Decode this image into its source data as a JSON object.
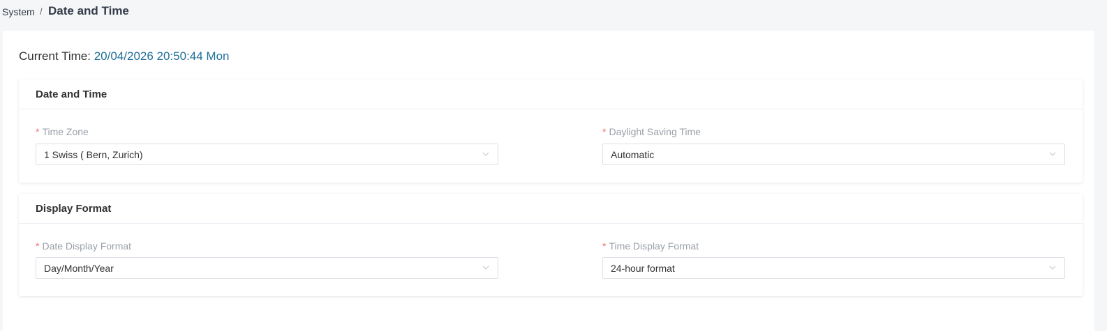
{
  "breadcrumb": {
    "parent": "System",
    "separator": "/",
    "current": "Date and Time"
  },
  "current_time": {
    "label": "Current Time:",
    "value": "20/04/2026 20:50:44 Mon"
  },
  "sections": [
    {
      "title": "Date and Time",
      "fields": [
        {
          "label": "Time Zone",
          "required": "*",
          "value": "1 Swiss ( Bern, Zurich)"
        },
        {
          "label": "Daylight Saving Time",
          "required": "*",
          "value": "Automatic"
        }
      ]
    },
    {
      "title": "Display Format",
      "fields": [
        {
          "label": "Date Display Format",
          "required": "*",
          "value": "Day/Month/Year"
        },
        {
          "label": "Time Display Format",
          "required": "*",
          "value": "24-hour format"
        }
      ]
    }
  ],
  "colors": {
    "accent": "#1f6f99",
    "required": "#f56c6c",
    "label": "#9aa0a8",
    "background": "#f5f6f8"
  }
}
